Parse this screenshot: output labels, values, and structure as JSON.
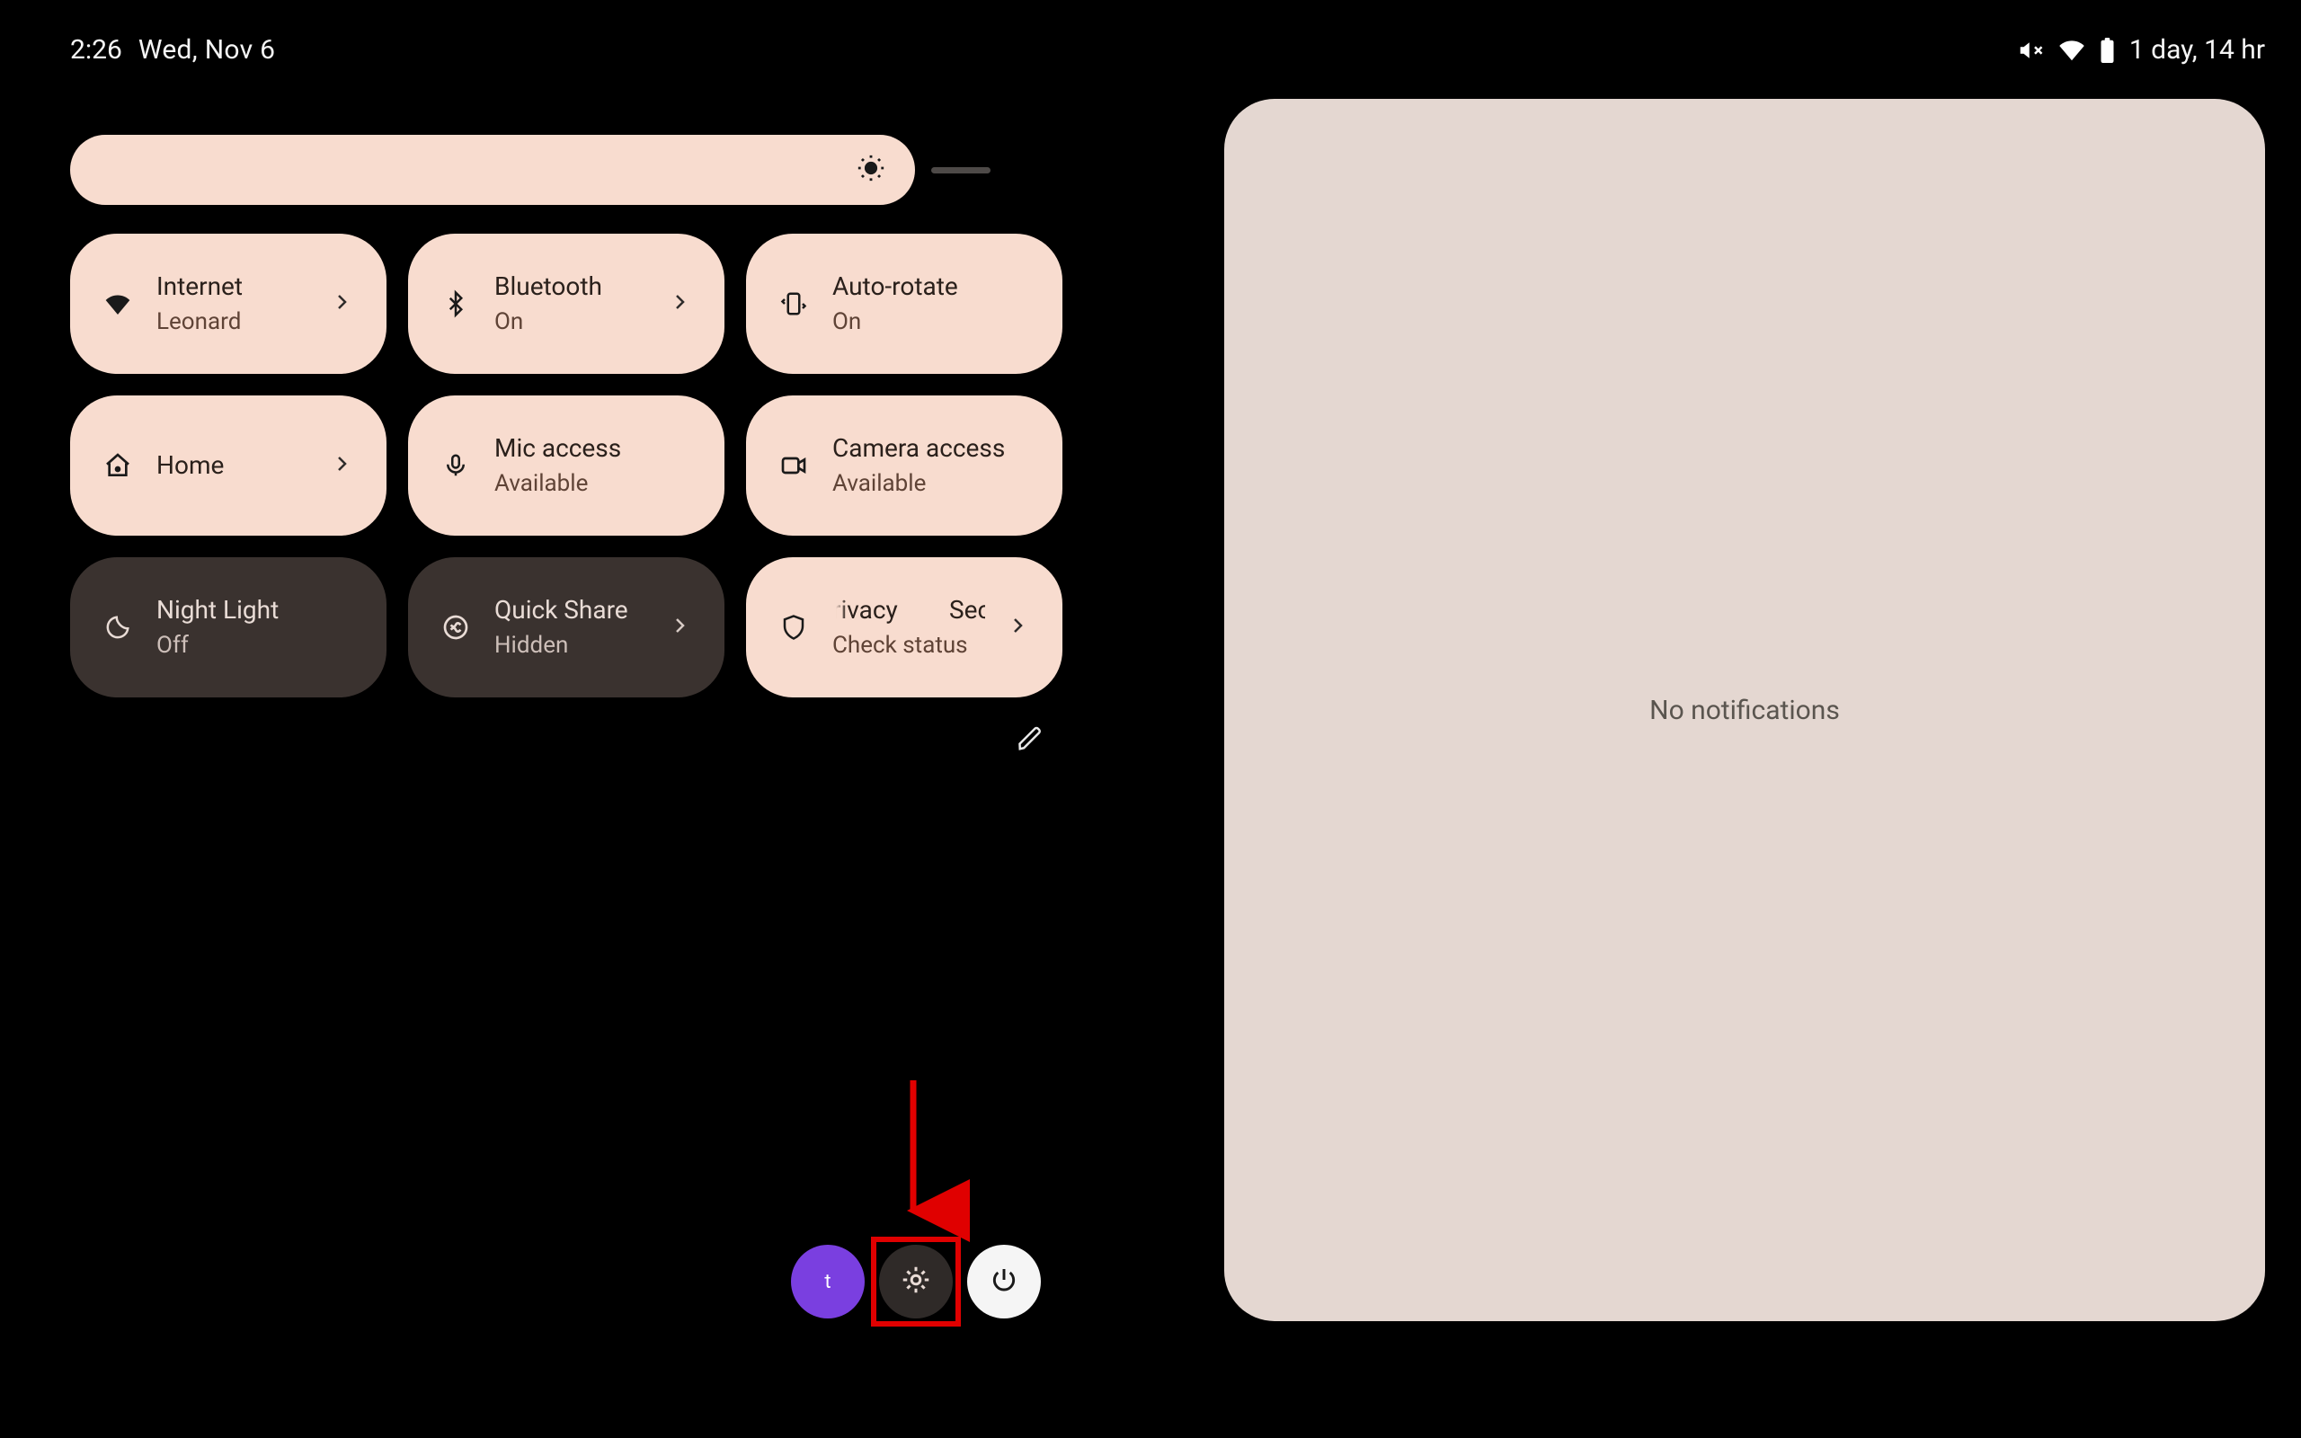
{
  "status": {
    "time": "2:26",
    "date": "Wed, Nov 6",
    "battery_text": "1 day, 14 hr"
  },
  "notifications": {
    "empty_text": "No notifications"
  },
  "tiles": [
    {
      "id": "internet",
      "title": "Internet",
      "sub": "Leonard",
      "state": "on",
      "chevron": true
    },
    {
      "id": "bluetooth",
      "title": "Bluetooth",
      "sub": "On",
      "state": "on",
      "chevron": true
    },
    {
      "id": "autorotate",
      "title": "Auto-rotate",
      "sub": "On",
      "state": "on",
      "chevron": false
    },
    {
      "id": "home",
      "title": "Home",
      "sub": "",
      "state": "on",
      "chevron": true
    },
    {
      "id": "mic",
      "title": "Mic access",
      "sub": "Available",
      "state": "on",
      "chevron": false
    },
    {
      "id": "camera",
      "title": "Camera access",
      "sub": "Available",
      "state": "on",
      "chevron": false
    },
    {
      "id": "nightlight",
      "title": "Night Light",
      "sub": "Off",
      "state": "off",
      "chevron": false
    },
    {
      "id": "quickshare",
      "title": "Quick Share",
      "sub": "Hidden",
      "state": "off",
      "chevron": true
    },
    {
      "id": "security",
      "title": "rivacy",
      "title2": "Sec",
      "sub": "Check status",
      "state": "on",
      "chevron": true
    }
  ],
  "bottom": {
    "user_initial": "t"
  }
}
